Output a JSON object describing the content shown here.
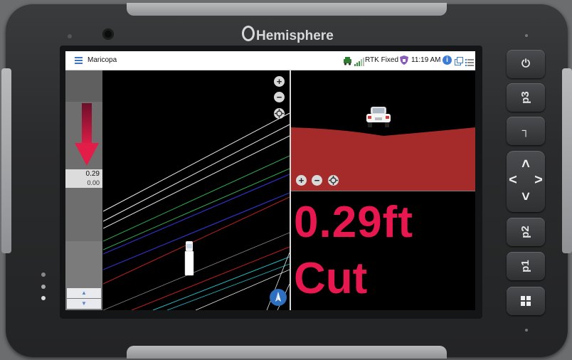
{
  "device": {
    "brand": "Hemisphere",
    "keys": [
      {
        "id": "power",
        "icon": "power-icon",
        "label": "⏻"
      },
      {
        "id": "p3",
        "label": "p3"
      },
      {
        "id": "enter",
        "icon": "return-icon",
        "label": "┐"
      },
      {
        "id": "dpad",
        "up": "˄",
        "down": "˅",
        "left": "˂",
        "right": "˃"
      },
      {
        "id": "p2",
        "label": "p2"
      },
      {
        "id": "p1",
        "label": "p1"
      },
      {
        "id": "windows",
        "icon": "windows-icon"
      }
    ]
  },
  "statusbar": {
    "menu_icon": "hamburger-menu-icon",
    "project": "Maricopa",
    "fix_status": "RTK Fixed",
    "time": "11:19 AM",
    "icons": [
      "machine-icon",
      "signal-icon",
      "shield-icon",
      "info-icon",
      "windows-switch-icon",
      "list-icon"
    ]
  },
  "gauge": {
    "direction_icon": "down-arrow-icon",
    "value": "0.29",
    "target": "0.00",
    "scroll_up": "▲",
    "scroll_down": "▼"
  },
  "plan_view": {
    "zoom_in": "+",
    "zoom_out": "−",
    "center_icon": "crosshair-icon",
    "compass_icon": "compass-icon"
  },
  "profile_view": {
    "zoom_in": "+",
    "zoom_out": "−",
    "center_icon": "crosshair-icon",
    "cut_fill_color": "#a52a2a"
  },
  "readout": {
    "value": "0.29ft",
    "state": "Cut",
    "color": "#e8174f"
  }
}
